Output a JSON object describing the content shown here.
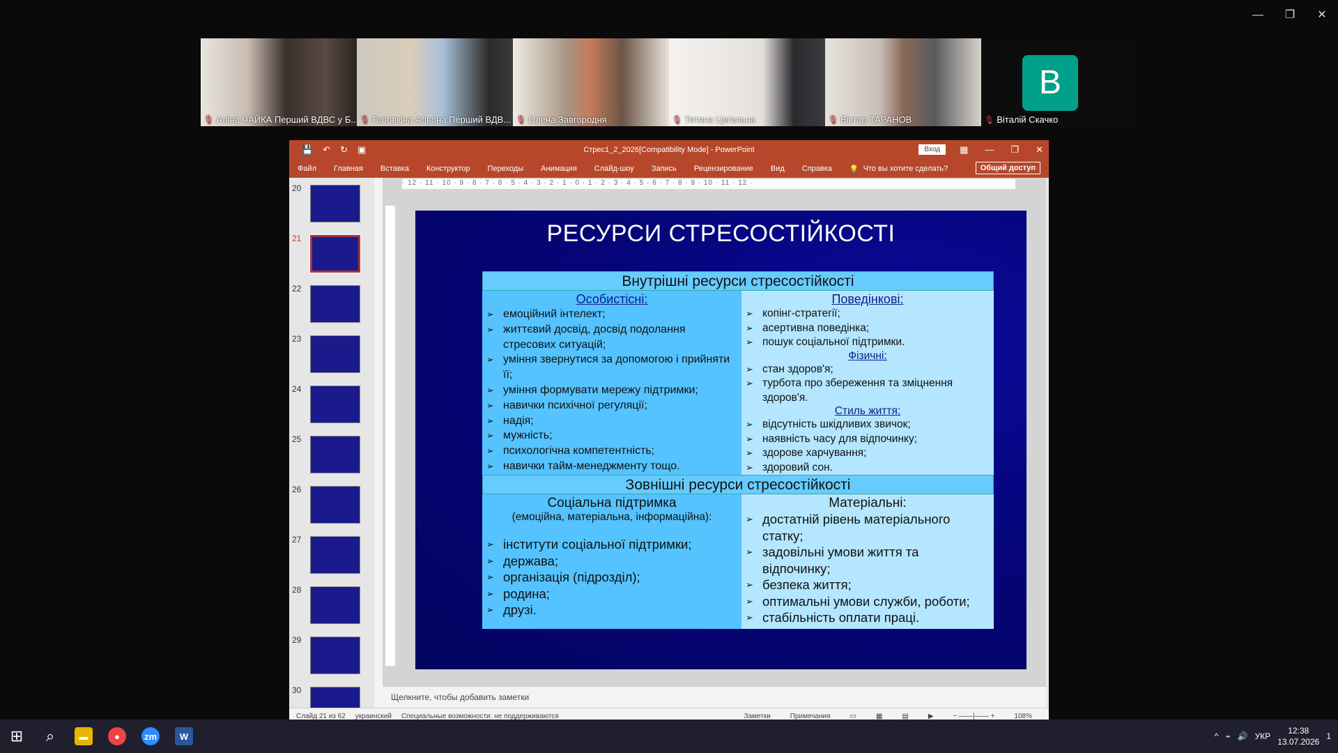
{
  "zoom": {
    "window_controls": [
      "—",
      "❐",
      "✕"
    ],
    "participants": [
      {
        "name": "Аліна ЧАЙКА Перший ВДВС у Б...",
        "bg": "#b9a79c"
      },
      {
        "name": "Головкіна Альона Перший ВДВ...",
        "bg": "#a8a39d"
      },
      {
        "name": "Олена Завгородня",
        "bg": "#8d7f70"
      },
      {
        "name": "Тетяна Цегельна",
        "bg": "#c9c5c1"
      },
      {
        "name": "Віктор ТАРАНОВ",
        "bg": "#b0a79e"
      },
      {
        "name": "Віталій Скачко",
        "initial": "B",
        "bg": "#0d0d0d"
      }
    ]
  },
  "ppt": {
    "title": "Стрес1_2_2026[Compatibility Mode]  -  PowerPoint",
    "login": "Вход",
    "ribbon_tabs": [
      "Файл",
      "Главная",
      "Вставка",
      "Конструктор",
      "Переходы",
      "Анимация",
      "Слайд-шоу",
      "Запись",
      "Рецензирование",
      "Вид",
      "Справка"
    ],
    "tell_me": "Что вы хотите сделать?",
    "share": "Общий доступ",
    "ruler": "· 12 · 11 · 10 · 9 · 8 · 7 · 6 · 5 · 4 · 3 · 2 · 1 · 0 · 1 · 2 · 3 · 4 · 5 · 6 · 7 · 8 · 9 · 10 · 11 · 12 ·",
    "thumbs": [
      "20",
      "21",
      "22",
      "23",
      "24",
      "25",
      "26",
      "27",
      "28",
      "29",
      "30"
    ],
    "selected_thumb": "21",
    "notes_placeholder": "Щелкните, чтобы добавить заметки",
    "status": {
      "slide": "Слайд 21 из 62",
      "lang": "украинский",
      "access": "Специальные возможности: не поддерживаются",
      "notes": "Заметки",
      "comments": "Примечания",
      "zoom": "108%"
    }
  },
  "slide": {
    "title": "РЕСУРСИ СТРЕСОСТІЙКОСТІ",
    "internal_header": "Внутрішні ресурси стресостійкості",
    "personal_title": "Особистісні:",
    "personal": [
      "емоційний інтелект;",
      "життєвий досвід, досвід подолання стресових ситуацій;",
      "уміння звернутися за допомогою і прийняти її;",
      "уміння формувати мережу підтримки;",
      "навички психічної регуляції;",
      "надія;",
      "мужність;",
      "психологічна компетентність;",
      "навички тайм-менеджменту тощо."
    ],
    "behavioral_title": "Поведінкові:",
    "behavioral": [
      "копінг-стратегії;",
      "асертивна поведінка;",
      "пошук соціальної підтримки."
    ],
    "physical_title": "Фізичні:",
    "physical": [
      "стан здоров'я;",
      "турбота про збереження та зміцнення здоров'я."
    ],
    "lifestyle_title": "Стиль життя:",
    "lifestyle": [
      "відсутність шкідливих звичок;",
      "наявність часу для відпочинку;",
      "здорове харчування;",
      "здоровий сон."
    ],
    "external_header": "Зовнішні ресурси стресостійкості",
    "social_title": "Соціальна підтримка",
    "social_sub": "(емоційна, матеріальна, інформаційна):",
    "social": [
      "інститути соціальної підтримки;",
      "держава;",
      "організація (підрозділ);",
      "родина;",
      "друзі."
    ],
    "material_title": "Матеріальні:",
    "material": [
      "достатній рівень матеріального статку;",
      "задовільні умови життя та відпочинку;",
      "безпека життя;",
      "оптимальні умови служби, роботи;",
      "стабільність оплати праці."
    ]
  },
  "taskbar": {
    "lang": "УКР",
    "time": "12:38",
    "date": "13.07.2026",
    "notif": "1"
  }
}
